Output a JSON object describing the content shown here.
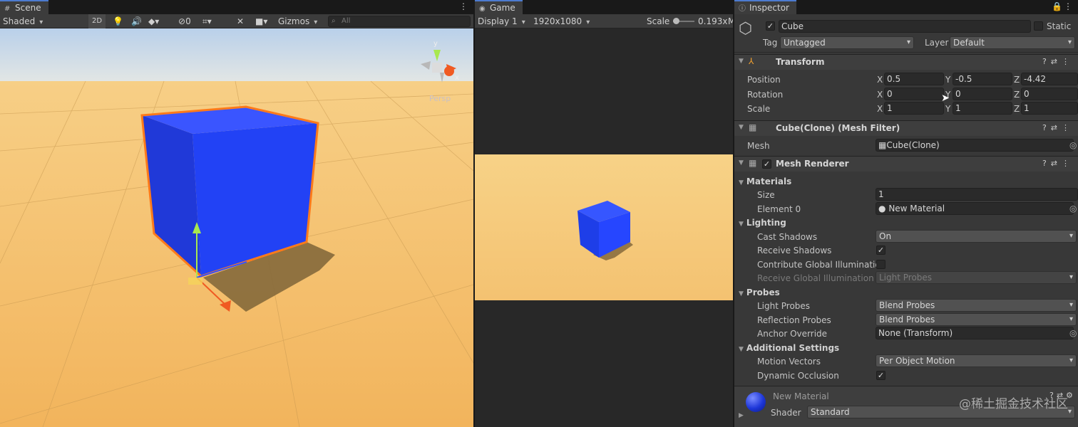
{
  "scene": {
    "tab": "Scene",
    "shading": "Shaded",
    "mode2d": "2D",
    "hidden_count": "0",
    "gizmos": "Gizmos",
    "search_placeholder": "All",
    "persp": "Persp",
    "axis_y": "y",
    "axis_x": "x"
  },
  "game": {
    "tab": "Game",
    "display": "Display 1",
    "resolution": "1920x1080",
    "scale_label": "Scale",
    "scale_value": "0.193x",
    "cut": "M"
  },
  "inspector": {
    "tab": "Inspector",
    "object_name": "Cube",
    "static_label": "Static",
    "tag_label": "Tag",
    "tag_value": "Untagged",
    "layer_label": "Layer",
    "layer_value": "Default",
    "transform": {
      "title": "Transform",
      "position_label": "Position",
      "rotation_label": "Rotation",
      "scale_label": "Scale",
      "position": {
        "x": "0.5",
        "y": "-0.5",
        "z": "-4.42"
      },
      "rotation": {
        "x": "0",
        "y": "0",
        "z": "0"
      },
      "scale": {
        "x": "1",
        "y": "1",
        "z": "1"
      }
    },
    "mesh_filter": {
      "title": "Cube(Clone) (Mesh Filter)",
      "mesh_label": "Mesh",
      "mesh_value": "Cube(Clone)"
    },
    "mesh_renderer": {
      "title": "Mesh Renderer",
      "materials": "Materials",
      "size_label": "Size",
      "size_value": "1",
      "element_label": "Element 0",
      "element_value": "New Material",
      "lighting": "Lighting",
      "cast_shadows_label": "Cast Shadows",
      "cast_shadows_value": "On",
      "receive_shadows_label": "Receive Shadows",
      "contribute_gi_label": "Contribute Global Illumination",
      "receive_gi_label": "Receive Global Illumination",
      "receive_gi_value": "Light Probes",
      "probes": "Probes",
      "light_probes_label": "Light Probes",
      "light_probes_value": "Blend Probes",
      "reflection_probes_label": "Reflection Probes",
      "reflection_probes_value": "Blend Probes",
      "anchor_label": "Anchor Override",
      "anchor_value": "None (Transform)",
      "additional": "Additional Settings",
      "motion_vectors_label": "Motion Vectors",
      "motion_vectors_value": "Per Object Motion",
      "dynamic_occlusion_label": "Dynamic Occlusion"
    },
    "material": {
      "name": "New Material",
      "shader_label": "Shader",
      "shader_value": "Standard"
    }
  },
  "watermark": "@稀土掘金技术社区",
  "colors": {
    "cube": "#2244ff",
    "ground": "#f2b962",
    "selection": "#ff7a1a"
  }
}
